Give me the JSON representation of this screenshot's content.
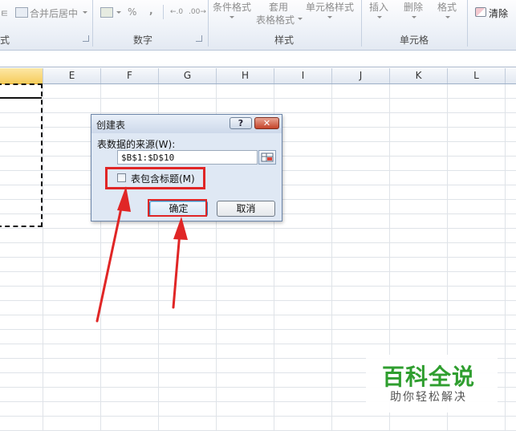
{
  "ribbon": {
    "alignment_fragment": "ㅌ",
    "merge_center_label": "合并后居中",
    "percent_symbol": "%",
    "comma_symbol": ",",
    "conditional_format_label": "条件格式",
    "table_format_line1": "套用",
    "table_format_line2": "表格格式",
    "cell_style_label": "单元格样式",
    "insert_label": "插入",
    "delete_label": "删除",
    "format_label": "格式",
    "clear_label": "清除",
    "groups": {
      "alignment": "式",
      "number": "数字",
      "styles": "样式",
      "cells": "单元格"
    }
  },
  "grid": {
    "columns": [
      "E",
      "F",
      "G",
      "H",
      "I",
      "J",
      "K",
      "L"
    ]
  },
  "dialog": {
    "title": "创建表",
    "help_symbol": "?",
    "close_symbol": "✕",
    "source_label": "表数据的来源(W):",
    "range_value": "$B$1:$D$10",
    "header_checkbox_label": "表包含标题(M)",
    "header_checkbox_checked": false,
    "ok_label": "确定",
    "cancel_label": "取消"
  },
  "watermark": {
    "title": "百科全说",
    "subtitle": "助你轻松解决"
  },
  "colors": {
    "annotation_red": "#e02626",
    "watermark_green": "#2f9e2f",
    "selected_column_header": "#f6cd5c"
  }
}
